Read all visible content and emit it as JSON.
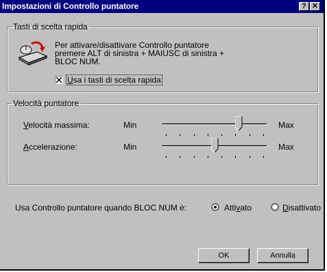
{
  "dialog": {
    "title": "Impostazioni di Controllo puntatore",
    "help_glyph": "?",
    "close_glyph": "✕"
  },
  "shortcuts": {
    "group_title": "Tasti di scelta rapida",
    "icon": "mouse-keyboard-icon",
    "description": [
      "Per attivare/disattivare Controllo puntatore",
      "premere ALT di sinistra + MAIUSC di sinistra +",
      "BLOC NUM."
    ],
    "checkbox_label": "Usa i tasti di scelta rapida",
    "checkbox_mnemonic": "U",
    "checkbox_rest": "sa i tasti di scelta rapida",
    "checked": true
  },
  "speed": {
    "group_title": "Velocità puntatore",
    "max_speed": {
      "label": "Velocità massima:",
      "mnemonic": "V",
      "rest": "elocità massima:",
      "min_label": "Min",
      "max_label": "Max",
      "value": 0.75
    },
    "acceleration": {
      "label": "Accelerazione:",
      "mnemonic": "A",
      "rest": "ccelerazione:",
      "min_label": "Min",
      "max_label": "Max",
      "value": 0.5
    },
    "tick_count": 8
  },
  "numlock": {
    "prompt": "Usa Controllo puntatore quando BLOC NUM è:",
    "options": [
      {
        "label": "Attivato",
        "pre": "Atti",
        "mnemonic": "v",
        "post": "ato",
        "selected": true
      },
      {
        "label": "Disattivato",
        "pre": "",
        "mnemonic": "D",
        "post": "isattivato",
        "selected": false
      }
    ]
  },
  "buttons": {
    "ok": "OK",
    "cancel": "Annulla"
  }
}
